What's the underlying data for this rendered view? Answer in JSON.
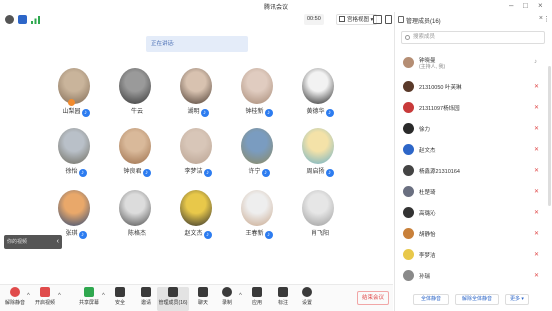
{
  "window": {
    "title": "腾讯会议"
  },
  "toolbar": {
    "timer": "00:50",
    "view_label": "宫格视图",
    "icons": [
      "info-icon",
      "shield-icon",
      "signal-icon",
      "fullscreen-icon",
      "popout-icon",
      "grid-icon"
    ]
  },
  "banner": {
    "text": "正在讲话:"
  },
  "tiles": [
    {
      "name": "山梨园",
      "mic": "on",
      "colors": [
        "#c9b49b",
        "#7e6852"
      ]
    },
    {
      "name": "牛云",
      "mic": "off",
      "colors": [
        "#9a9a9a",
        "#333333"
      ]
    },
    {
      "name": "湖明",
      "mic": "on",
      "colors": [
        "#d8c2b0",
        "#4a3a30"
      ]
    },
    {
      "name": "钟桂新",
      "mic": "on",
      "colors": [
        "#e0ccc0",
        "#a58874"
      ]
    },
    {
      "name": "黄德华",
      "mic": "on",
      "colors": [
        "#f2f2f2",
        "#222222"
      ]
    },
    {
      "name": "徐怡",
      "mic": "on",
      "colors": [
        "#b9c0c8",
        "#6d6a5d"
      ]
    },
    {
      "name": "钟良君",
      "mic": "on",
      "colors": [
        "#d9b99a",
        "#9a6c48"
      ]
    },
    {
      "name": "李梦洁",
      "mic": "on",
      "colors": [
        "#d8c6b8",
        "#b8a190"
      ]
    },
    {
      "name": "许宁",
      "mic": "on",
      "colors": [
        "#7a9cc0",
        "#8d8a60"
      ]
    },
    {
      "name": "周启扬",
      "mic": "on",
      "colors": [
        "#f4e2a8",
        "#6ab0c8"
      ]
    },
    {
      "name": "张琪",
      "mic": "on",
      "colors": [
        "#e9a86a",
        "#2e4a78"
      ]
    },
    {
      "name": "陈格杰",
      "mic": "off",
      "colors": [
        "#dcdcdc",
        "#4a4a4a"
      ]
    },
    {
      "name": "赵文杰",
      "mic": "on",
      "colors": [
        "#e8c84a",
        "#2c2c2c"
      ]
    },
    {
      "name": "王春新",
      "mic": "on",
      "colors": [
        "#eeeeee",
        "#c8a78c"
      ]
    },
    {
      "name": "肖飞阳",
      "mic": "off",
      "colors": [
        "#e6e6e6",
        "#9a9a9a"
      ]
    }
  ],
  "self_preview": {
    "label": "你的视频"
  },
  "bottombar": {
    "items": [
      {
        "label": "解除静音",
        "icon": "mic-muted-icon"
      },
      {
        "label": "开启视频",
        "icon": "camera-off-icon"
      },
      {
        "label": "共享屏幕",
        "icon": "share-screen-icon"
      },
      {
        "label": "安全",
        "icon": "security-icon"
      },
      {
        "label": "邀请",
        "icon": "invite-icon"
      },
      {
        "label": "管理成员(16)",
        "icon": "members-icon"
      },
      {
        "label": "聊天",
        "icon": "chat-icon"
      },
      {
        "label": "录制",
        "icon": "record-icon"
      },
      {
        "label": "应用",
        "icon": "apps-icon"
      },
      {
        "label": "标注",
        "icon": "annotate-icon"
      },
      {
        "label": "设置",
        "icon": "settings-icon"
      }
    ],
    "end_label": "结束会议"
  },
  "panel": {
    "title": "管理成员(16)",
    "search_placeholder": "搜索成员",
    "participants": [
      {
        "name": "钟晓曼",
        "note": "(主持人, 我)",
        "color": "#b58e74",
        "mic": "on"
      },
      {
        "name": "21310050 叶芙琳",
        "color": "#5a3a2a",
        "mic": "off"
      },
      {
        "name": "21311097杨烁园",
        "color": "#c83a3a",
        "mic": "off"
      },
      {
        "name": "徐力",
        "color": "#2a2a2a",
        "mic": "off"
      },
      {
        "name": "赵文杰",
        "color": "#2d66c8",
        "mic": "off"
      },
      {
        "name": "杨鑫源21310164",
        "color": "#444444",
        "mic": "off"
      },
      {
        "name": "杜楚琦",
        "color": "#6a6f80",
        "mic": "off"
      },
      {
        "name": "高璐沁",
        "color": "#333333",
        "mic": "off"
      },
      {
        "name": "胡静怡",
        "color": "#c8803a",
        "mic": "off"
      },
      {
        "name": "李梦洁",
        "color": "#e8c84a",
        "mic": "off"
      },
      {
        "name": "孙瑞",
        "color": "#8a8a8a",
        "mic": "off"
      }
    ],
    "footer": {
      "mute_all": "全体静音",
      "unmute_all": "解除全体静音",
      "more": "更多"
    }
  }
}
